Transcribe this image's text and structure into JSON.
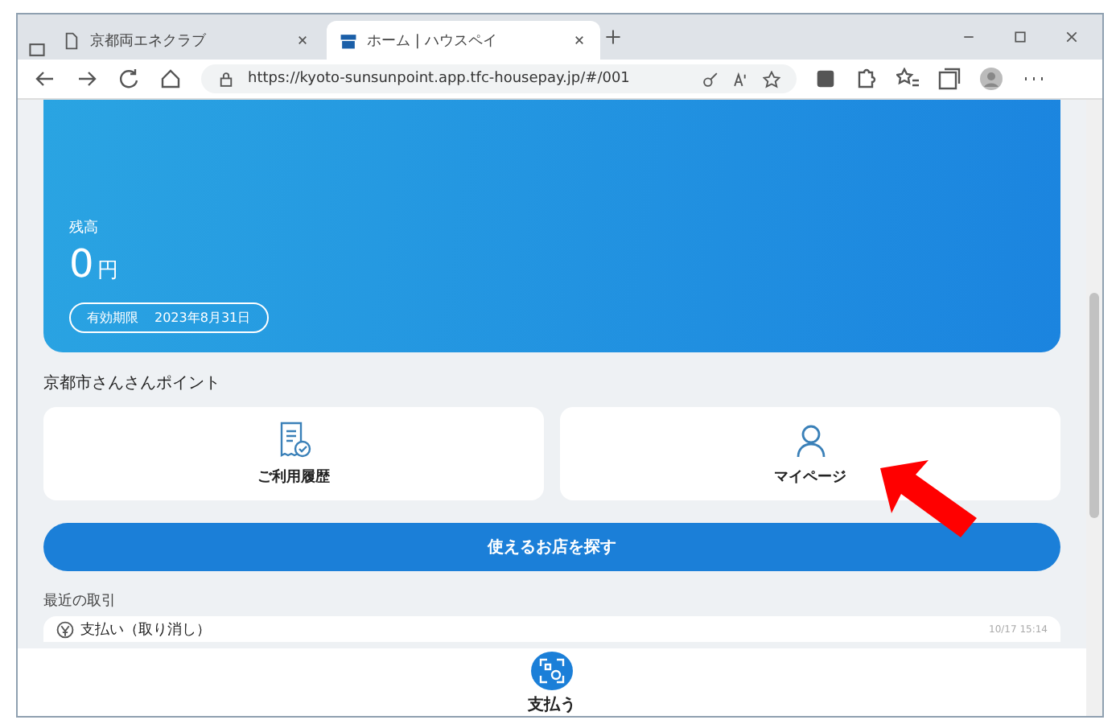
{
  "browser": {
    "tabs": [
      {
        "title": "京都両エネクラブ",
        "selected": false
      },
      {
        "title": "ホーム | ハウスペイ",
        "selected": true
      }
    ],
    "url": "https://kyoto-sunsunpoint.app.tfc-housepay.jp/#/001"
  },
  "balance": {
    "label": "残高",
    "amount": "0",
    "unit": "円",
    "expiry_label": "有効期限",
    "expiry_date": "2023年8月31日"
  },
  "section_title": "京都市さんさんポイント",
  "tiles": [
    {
      "label": "ご利用履歴"
    },
    {
      "label": "マイページ"
    }
  ],
  "find_button": "使えるお店を探す",
  "recent_title": "最近の取引",
  "transactions": [
    {
      "label": "支払い（取り消し）",
      "time": "10/17 15:14"
    }
  ],
  "bottom_nav": {
    "label": "支払う"
  }
}
